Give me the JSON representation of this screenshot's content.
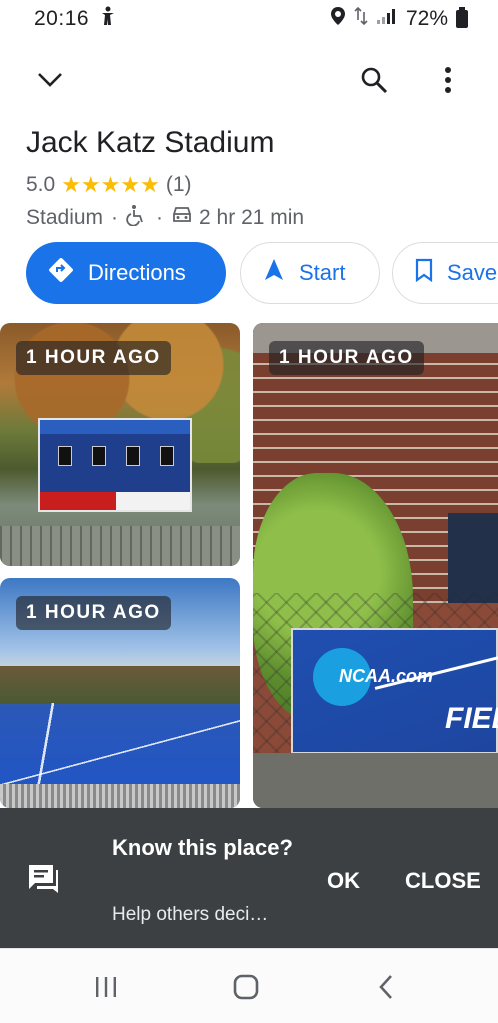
{
  "status_bar": {
    "time": "20:16",
    "battery": "72%"
  },
  "place": {
    "title": "Jack Katz Stadium",
    "rating": "5.0",
    "stars": "★★★★★",
    "review_count": "(1)",
    "category": "Stadium",
    "separator": "·",
    "drive_time": "2 hr 21 min"
  },
  "actions": {
    "directions": "Directions",
    "start": "Start",
    "save": "Save"
  },
  "photos": [
    {
      "time": "1 HOUR AGO"
    },
    {
      "time": "1 HOUR AGO"
    },
    {
      "time": "1 HOUR AGO"
    }
  ],
  "photo_text": {
    "banner_text": "NCAA.com",
    "banner_text2": "FIEL"
  },
  "snackbar": {
    "title": "Know this place?",
    "subtitle": "Help others deci…",
    "ok_label": "OK",
    "close_label": "CLOSE"
  },
  "colors": {
    "accent": "#1a73e8",
    "star": "#fbbc04",
    "snackbar_bg": "#3c4043"
  },
  "icons": {
    "status": [
      "accessibility-person-icon",
      "location-pin-icon",
      "data-arrows-icon",
      "signal-icon",
      "battery-icon"
    ],
    "app_bar": [
      "chevron-down-icon",
      "search-icon",
      "more-vert-icon"
    ],
    "meta": [
      "wheelchair-icon",
      "car-icon"
    ],
    "actions": [
      "directions-icon",
      "navigation-arrow-icon",
      "bookmark-icon"
    ],
    "snackbar": [
      "feedback-chat-icon"
    ],
    "nav": [
      "recent-apps-icon",
      "home-icon",
      "back-icon"
    ]
  }
}
